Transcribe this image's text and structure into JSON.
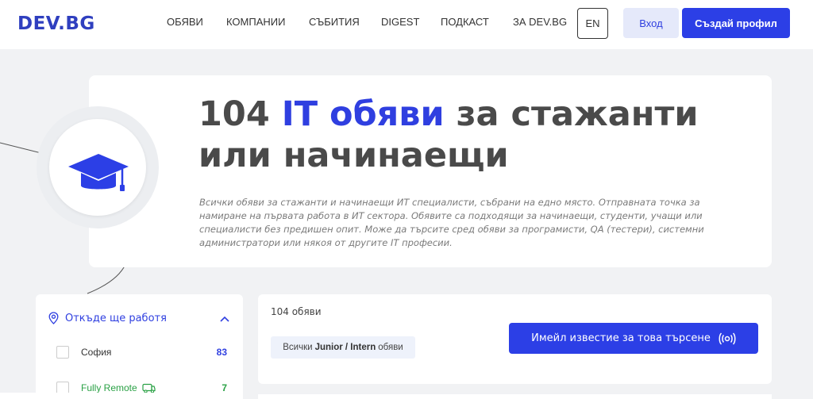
{
  "header": {
    "logo": "DEV.BG",
    "nav": [
      {
        "label": "ОБЯВИ"
      },
      {
        "label": "КОМПАНИИ"
      },
      {
        "label": "СЪБИТИЯ"
      },
      {
        "label": "DIGEST"
      },
      {
        "label": "ПОДКАСТ"
      },
      {
        "label": "ЗА DEV.BG"
      }
    ],
    "lang": "EN",
    "login": "Вход",
    "signup": "Създай профил"
  },
  "hero": {
    "count": "104",
    "accent": "IT обяви",
    "title_rest": "за стажанти или начинаещи",
    "description": "Всички обяви за стажанти и начинаещи ИТ специалисти, събрани на едно място. Отправната точка за намиране на първата работа в ИТ сектора. Обявите са подходящи за начинаещи, студенти, учащи или специалисти без предишен опит. Може да търсите сред обяви за програмисти, QA (тестери), системни администратори или някоя от другите IT професии.",
    "icon": "graduation-cap-icon"
  },
  "filter": {
    "title": "Откъде ще работя",
    "items": [
      {
        "label": "София",
        "count": "83"
      },
      {
        "label": "Fully Remote",
        "count": "7"
      }
    ]
  },
  "results": {
    "count_label": "104 обяви",
    "tag_prefix": "Всички",
    "tag_bold": "Junior / Intern",
    "tag_suffix": "обяви",
    "alert_button": "Имейл известие за това търсене"
  },
  "colors": {
    "accent": "#2c3fe6",
    "remote": "#2aa145"
  }
}
